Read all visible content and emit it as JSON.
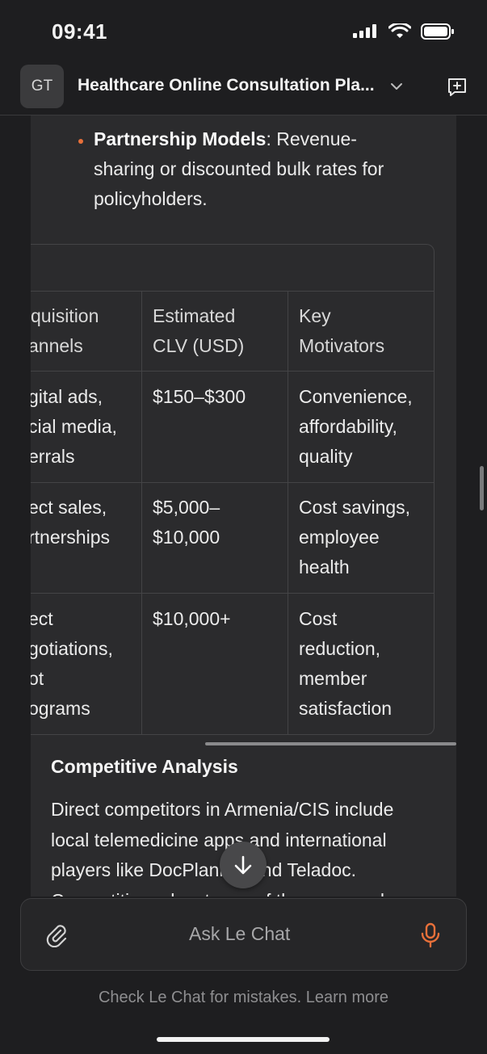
{
  "status_bar": {
    "time": "09:41"
  },
  "header": {
    "avatar_initials": "GT",
    "title": "Healthcare Online Consultation Pla...",
    "chevron_icon": "chevron-down-icon",
    "new_chat_icon": "new-chat-icon"
  },
  "bullet": {
    "term": "Partnership Models",
    "separator": ":",
    "line1_rest": " Revenue-",
    "line2": "sharing or discounted bulk rates for",
    "line3": "policyholders."
  },
  "table": {
    "headers": [
      {
        "l1": "quisition",
        "l2": "annels"
      },
      {
        "l1": "Estimated",
        "l2": "CLV (USD)"
      },
      {
        "l1": "Key",
        "l2": "Motivators"
      }
    ],
    "rows": [
      [
        [
          "gital ads,",
          "cial media,",
          "errals"
        ],
        [
          "$150–$300"
        ],
        [
          "Convenience,",
          "affordability,",
          "quality"
        ]
      ],
      [
        [
          "ect sales,",
          "rtnerships"
        ],
        [
          "$5,000–",
          "$10,000"
        ],
        [
          "Cost savings,",
          "employee",
          "health"
        ]
      ],
      [
        [
          "ect",
          "gotiations,",
          "ot",
          "ograms"
        ],
        [
          "$10,000+"
        ],
        [
          "Cost",
          "reduction,",
          "member",
          "satisfaction"
        ]
      ]
    ]
  },
  "section": {
    "heading": "Competitive Analysis",
    "paragraph_lines": [
      "Direct competitors in Armenia/CIS include",
      "local telemedicine apps and international",
      "players like DocPlanner and Teladoc.",
      "Competitive advantages of the proposed"
    ]
  },
  "input": {
    "placeholder": "Ask Le Chat"
  },
  "footer": {
    "disclaimer": "Check Le Chat for mistakes. Learn more"
  },
  "colors": {
    "accent": "#e8703a",
    "background": "#2b2b2d",
    "chrome": "#1e1e20"
  }
}
